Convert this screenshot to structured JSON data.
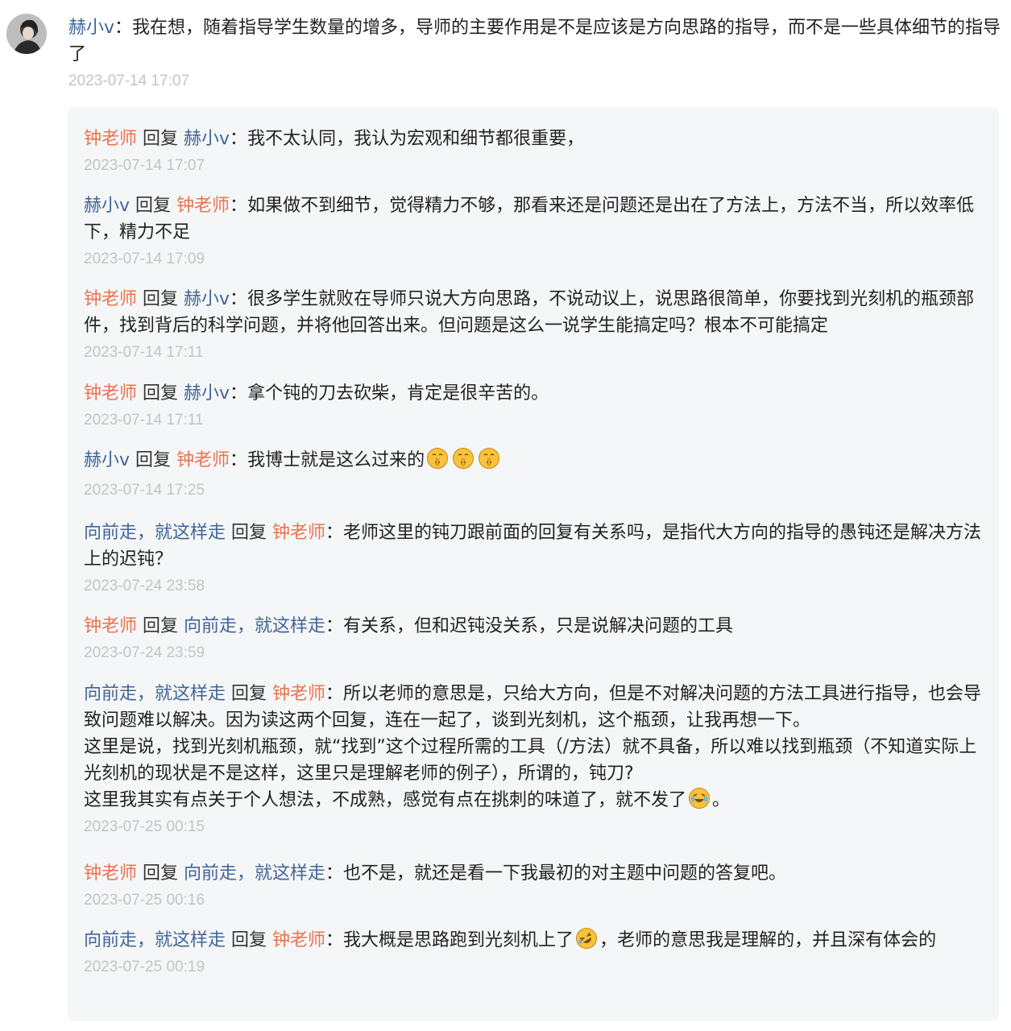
{
  "top_comment": {
    "author": "赫小v",
    "sep": "：",
    "text": "我在想，随着指导学生数量的增多，导师的主要作用是不是应该是方向思路的指导，而不是一些具体细节的指导了",
    "time": "2023-07-14 17:07"
  },
  "replies": [
    {
      "from": "钟老师",
      "word": " 回复 ",
      "to": "赫小v",
      "sep": "：",
      "text": "我不太认同，我认为宏观和细节都很重要，",
      "time": "2023-07-14 17:07"
    },
    {
      "from": "赫小v",
      "word": " 回复 ",
      "to": "钟老师",
      "sep": "：",
      "text": "如果做不到细节，觉得精力不够，那看来还是问题还是出在了方法上，方法不当，所以效率低下，精力不足",
      "time": "2023-07-14 17:09"
    },
    {
      "from": "钟老师",
      "word": " 回复 ",
      "to": "赫小v",
      "sep": "：",
      "text": "很多学生就败在导师只说大方向思路，不说动议上，说思路很简单，你要找到光刻机的瓶颈部件，找到背后的科学问题，并将他回答出来。但问题是这么一说学生能搞定吗？根本不可能搞定",
      "time": "2023-07-14 17:11"
    },
    {
      "from": "钟老师",
      "word": " 回复 ",
      "to": "赫小v",
      "sep": "：",
      "text": "拿个钝的刀去砍柴，肯定是很辛苦的。",
      "time": "2023-07-14 17:11"
    },
    {
      "from": "赫小v",
      "word": " 回复 ",
      "to": "钟老师",
      "sep": "：",
      "text": "我博士就是这么过来的",
      "emoji_after": [
        "shush-emoji",
        "shush-emoji",
        "shush-emoji"
      ],
      "time": "2023-07-14 17:25"
    },
    {
      "from": "向前走，就这样走",
      "word": " 回复 ",
      "to": "钟老师",
      "sep": "：",
      "text": "老师这里的钝刀跟前面的回复有关系吗，是指代大方向的指导的愚钝还是解决方法上的迟钝？",
      "time": "2023-07-24 23:58"
    },
    {
      "from": "钟老师",
      "word": " 回复 ",
      "to": "向前走，就这样走",
      "sep": "：",
      "text": "有关系，但和迟钝没关系，只是说解决问题的工具",
      "time": "2023-07-24 23:59"
    },
    {
      "from": "向前走，就这样走",
      "word": " 回复 ",
      "to": "钟老师",
      "sep": "：",
      "text": "所以老师的意思是，只给大方向，但是不对解决问题的方法工具进行指导，也会导致问题难以解决。因为读这两个回复，连在一起了，谈到光刻机，这个瓶颈，让我再想一下。",
      "text2": "这里是说，找到光刻机瓶颈，就“找到”这个过程所需的工具（/方法）就不具备，所以难以找到瓶颈（不知道实际上光刻机的现状是不是这样，这里只是理解老师的例子），所谓的，钝刀?",
      "text3": "这里我其实有点关于个人想法，不成熟，感觉有点在挑刺的味道了，就不发了",
      "text3_end": "。",
      "emoji_text3": "crying-laugh-emoji",
      "time": "2023-07-25 00:15"
    },
    {
      "from": "钟老师",
      "word": " 回复 ",
      "to": "向前走，就这样走",
      "sep": "：",
      "text": "也不是，就还是看一下我最初的对主题中问题的答复吧。",
      "time": "2023-07-25 00:16"
    },
    {
      "from": "向前走，就这样走",
      "word": " 回复 ",
      "to": "钟老师",
      "sep": "：",
      "text": "我大概是思路跑到光刻机上了",
      "emoji_mid": "rofl-emoji",
      "text_after": "，老师的意思我是理解的，并且深有体会的",
      "time": "2023-07-25 00:19"
    }
  ],
  "colors": {
    "teacher_name": "#eb7350",
    "user_name": "#406599",
    "timestamp": "#c4c4c4",
    "reply_bg": "#f5f6f7"
  }
}
